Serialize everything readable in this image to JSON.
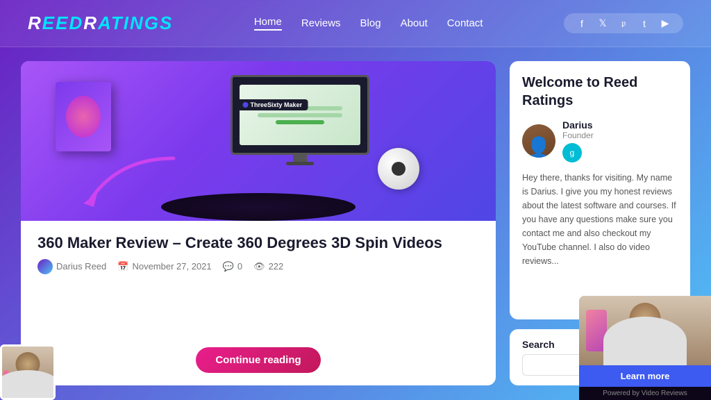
{
  "header": {
    "logo": "ReedRatings",
    "nav": {
      "items": [
        {
          "label": "Home",
          "active": true
        },
        {
          "label": "Reviews",
          "active": false
        },
        {
          "label": "Blog",
          "active": false
        },
        {
          "label": "About",
          "active": false
        },
        {
          "label": "Contact",
          "active": false
        }
      ]
    },
    "social": {
      "icons": [
        "f",
        "t",
        "p",
        "t",
        "yt"
      ]
    }
  },
  "article": {
    "image_alt": "360 Maker product image",
    "title": "360 Maker Review – Create 360 Degrees 3D Spin Videos",
    "meta": {
      "author": "Darius Reed",
      "date": "November 27, 2021",
      "comments": "0",
      "views": "222"
    },
    "continue_label": "Continue reading"
  },
  "sidebar": {
    "welcome_title": "Welcome to Reed Ratings",
    "author": {
      "name": "Darius",
      "role": "Founder",
      "social_icon": "g"
    },
    "description": "Hey there, thanks for visiting. My name is Darius. I give you my honest reviews about the latest software and courses. If you have any questions make sure you contact me and also checkout my YouTube channel. I also do video reviews...",
    "search": {
      "label": "Search",
      "placeholder": ""
    }
  },
  "video_popup": {
    "learn_more_label": "Learn more",
    "footer_label": "Powered by Video Reviews"
  }
}
